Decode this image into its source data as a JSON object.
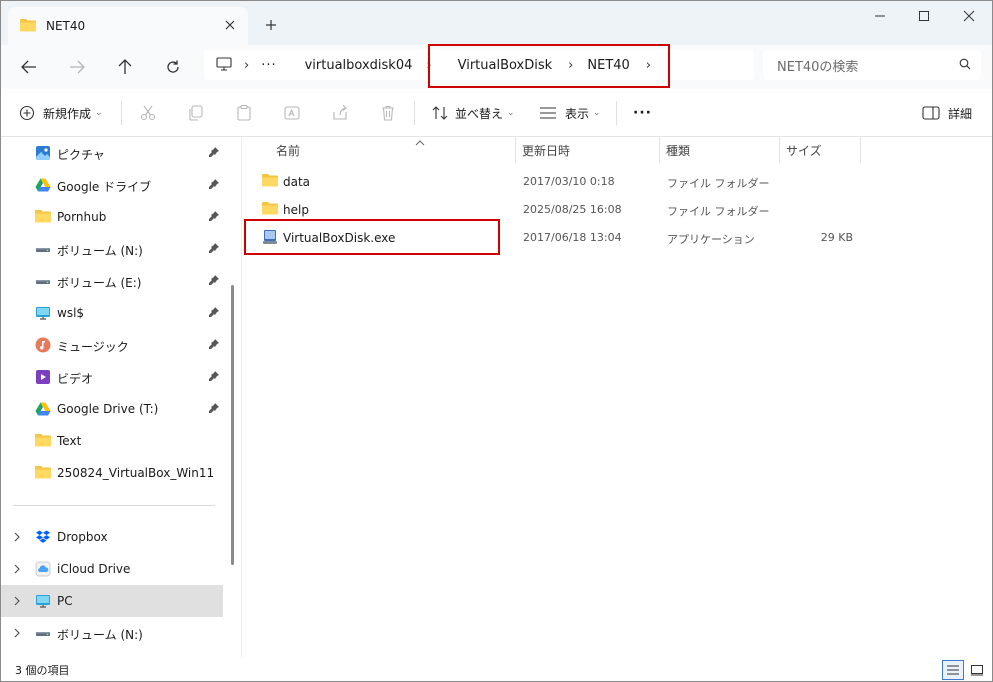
{
  "window": {
    "tab_title": "NET40",
    "new_tab_label": "+",
    "controls": {
      "minimize": "—",
      "maximize": "☐",
      "close": "✕"
    }
  },
  "address": {
    "overflow": "···",
    "breadcrumbs": [
      "virtualboxdisk04",
      "VirtualBoxDisk",
      "NET40"
    ],
    "search_placeholder": "NET40の検索"
  },
  "toolbar": {
    "new_label": "新規作成",
    "sort_label": "並べ替え",
    "view_label": "表示",
    "more_label": "···",
    "details_label": "詳細"
  },
  "sidebar": {
    "items": [
      {
        "label": "ピクチャ",
        "icon": "pictures-icon",
        "pinned": true
      },
      {
        "label": "Google ドライブ",
        "icon": "google-drive-icon",
        "pinned": true
      },
      {
        "label": "Pornhub",
        "icon": "folder-icon",
        "pinned": true
      },
      {
        "label": "ボリューム (N:)",
        "icon": "drive-icon",
        "pinned": true
      },
      {
        "label": "ボリューム (E:)",
        "icon": "drive-icon",
        "pinned": true
      },
      {
        "label": "wsl$",
        "icon": "network-drive-icon",
        "pinned": true
      },
      {
        "label": "ミュージック",
        "icon": "music-icon",
        "pinned": true
      },
      {
        "label": "ビデオ",
        "icon": "video-icon",
        "pinned": true
      },
      {
        "label": "Google Drive (T:)",
        "icon": "google-drive-icon",
        "pinned": true
      },
      {
        "label": "Text",
        "icon": "folder-icon",
        "pinned": false
      },
      {
        "label": "250824_VirtualBox_Win11",
        "icon": "folder-icon",
        "pinned": false
      }
    ],
    "locations": [
      {
        "label": "Dropbox",
        "icon": "dropbox-icon"
      },
      {
        "label": "iCloud Drive",
        "icon": "icloud-icon"
      },
      {
        "label": "PC",
        "icon": "pc-icon",
        "selected": true
      },
      {
        "label": "ボリューム (N:)",
        "icon": "drive-icon"
      }
    ]
  },
  "columns": {
    "name": "名前",
    "modified": "更新日時",
    "type": "種類",
    "size": "サイズ"
  },
  "files": [
    {
      "name": "data",
      "modified": "2017/03/10 0:18",
      "type": "ファイル フォルダー",
      "size": "",
      "icon": "folder-icon"
    },
    {
      "name": "help",
      "modified": "2025/08/25 16:08",
      "type": "ファイル フォルダー",
      "size": "",
      "icon": "folder-icon"
    },
    {
      "name": "VirtualBoxDisk.exe",
      "modified": "2017/06/18 13:04",
      "type": "アプリケーション",
      "size": "29 KB",
      "icon": "application-icon"
    }
  ],
  "status": {
    "item_count": "3 個の項目"
  },
  "colors": {
    "accent": "#3a7bd5",
    "highlight_box": "#d00000",
    "folder": "#f4c542"
  }
}
